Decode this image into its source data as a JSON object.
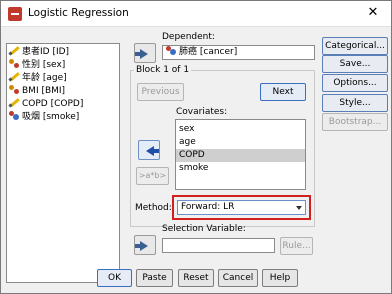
{
  "window": {
    "title": "Logistic Regression",
    "close_glyph": "✕",
    "icon": "spss-dialog-icon"
  },
  "variables": {
    "items": [
      {
        "label": "患者ID [ID]",
        "icon": "pencil-icon"
      },
      {
        "label": "性别 [sex]",
        "icon": "scale-icon"
      },
      {
        "label": "年龄 [age]",
        "icon": "pencil-icon"
      },
      {
        "label": "BMI [BMI]",
        "icon": "scale-icon"
      },
      {
        "label": "COPD [COPD]",
        "icon": "pencil-icon"
      },
      {
        "label": "吸烟 [smoke]",
        "icon": "nominal-icon"
      }
    ]
  },
  "dependent": {
    "label": "Dependent:",
    "value": "肺癌 [cancer]"
  },
  "block": {
    "label": "Block 1 of 1",
    "previous": "Previous",
    "next": "Next"
  },
  "covariates": {
    "label": "Covariates:",
    "items": [
      "sex",
      "age",
      "COPD",
      "smoke"
    ],
    "selected": "COPD"
  },
  "interaction_button": ">a*b>",
  "method": {
    "label": "Method:",
    "value": "Forward: LR"
  },
  "selection": {
    "label": "Selection Variable:",
    "value": "",
    "rule_button": "Rule..."
  },
  "side_buttons": [
    "Categorical...",
    "Save...",
    "Options...",
    "Style...",
    "Bootstrap..."
  ],
  "footer_buttons": [
    "OK",
    "Paste",
    "Reset",
    "Cancel",
    "Help"
  ]
}
